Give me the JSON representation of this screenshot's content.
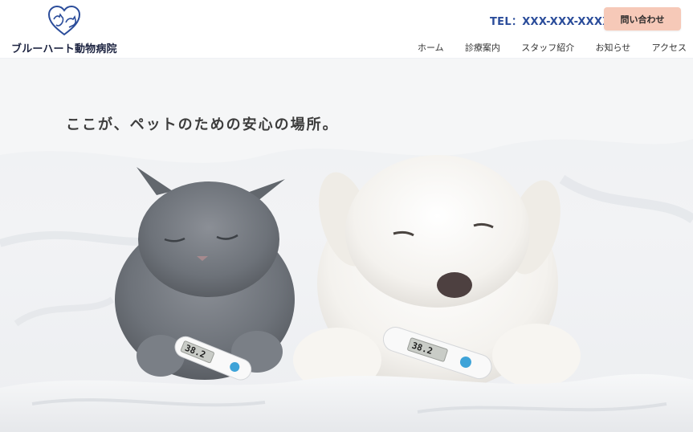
{
  "header": {
    "logo_text": "ブルーハート動物病院",
    "tel": "TEL：XXX-XXX-XXXX",
    "contact_label": "問い合わせ",
    "brand_color": "#2a4c9a",
    "contact_color": "#f6c9b8"
  },
  "nav": {
    "items": [
      {
        "label": "ホーム"
      },
      {
        "label": "診療案内"
      },
      {
        "label": "スタッフ紹介"
      },
      {
        "label": "お知らせ"
      },
      {
        "label": "アクセス"
      }
    ]
  },
  "hero": {
    "tagline": "ここが、ペットのための安心の場所。",
    "thermometer_cat": "38.2",
    "thermometer_dog": "38.2"
  },
  "icons": {
    "logo": "heart-pet-logo-icon"
  }
}
